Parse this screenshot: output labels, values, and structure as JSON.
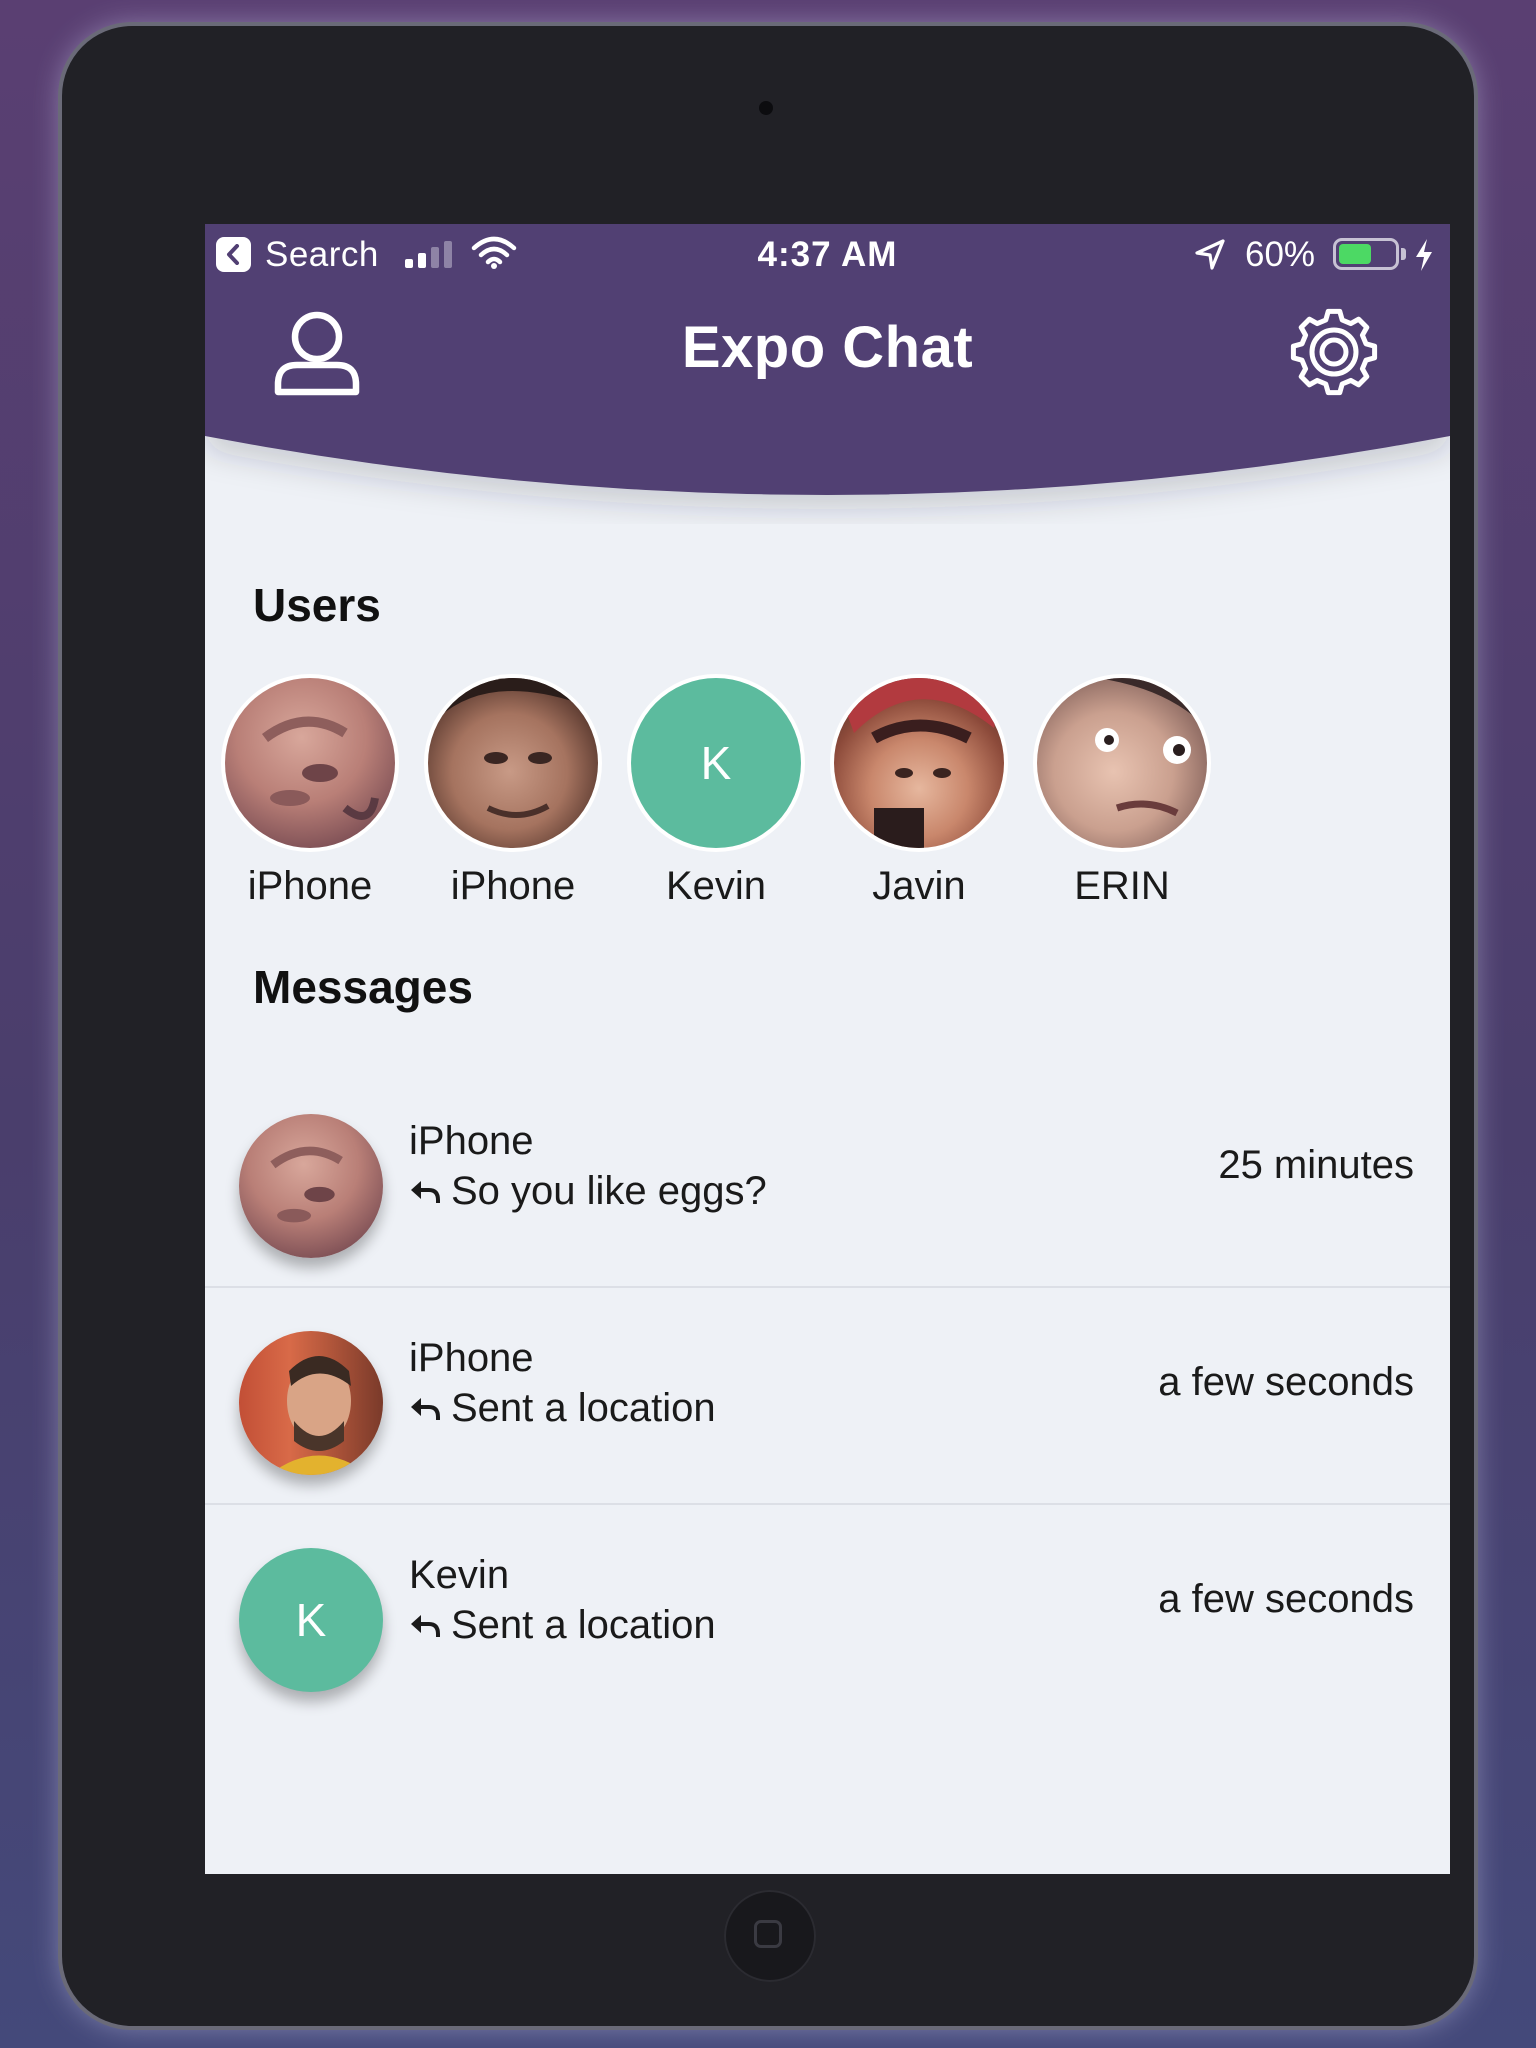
{
  "status_bar": {
    "back_label": "Search",
    "time": "4:37 AM",
    "battery_percent": "60%",
    "battery_level": 0.6,
    "signal_bars": 2,
    "icons": [
      "back-icon",
      "signal-icon",
      "wifi-icon",
      "location-arrow-icon",
      "battery-icon",
      "charging-bolt-icon"
    ]
  },
  "header": {
    "title": "Expo Chat",
    "left_icon": "user-icon",
    "right_icon": "settings-icon"
  },
  "users": {
    "title": "Users",
    "items": [
      {
        "name": "iPhone",
        "avatar_type": "photo",
        "avatar_letter": ""
      },
      {
        "name": "iPhone",
        "avatar_type": "photo",
        "avatar_letter": ""
      },
      {
        "name": "Kevin",
        "avatar_type": "letter",
        "avatar_letter": "K"
      },
      {
        "name": "Javin",
        "avatar_type": "photo",
        "avatar_letter": ""
      },
      {
        "name": "ERIN",
        "avatar_type": "photo",
        "avatar_letter": ""
      }
    ]
  },
  "messages": {
    "title": "Messages",
    "items": [
      {
        "sender": "iPhone",
        "preview": "So you like eggs?",
        "time": "25 minutes",
        "avatar_type": "photo",
        "avatar_letter": ""
      },
      {
        "sender": "iPhone",
        "preview": "Sent a location",
        "time": "a few seconds",
        "avatar_type": "photo",
        "avatar_letter": ""
      },
      {
        "sender": "Kevin",
        "preview": "Sent a location",
        "time": "a few seconds",
        "avatar_type": "letter",
        "avatar_letter": "K"
      }
    ]
  },
  "colors": {
    "header_purple": "#513f73",
    "background": "#eef1f6",
    "avatar_green": "#5cbb9e",
    "battery_green": "#4cd964",
    "text": "#1a1a1a"
  }
}
